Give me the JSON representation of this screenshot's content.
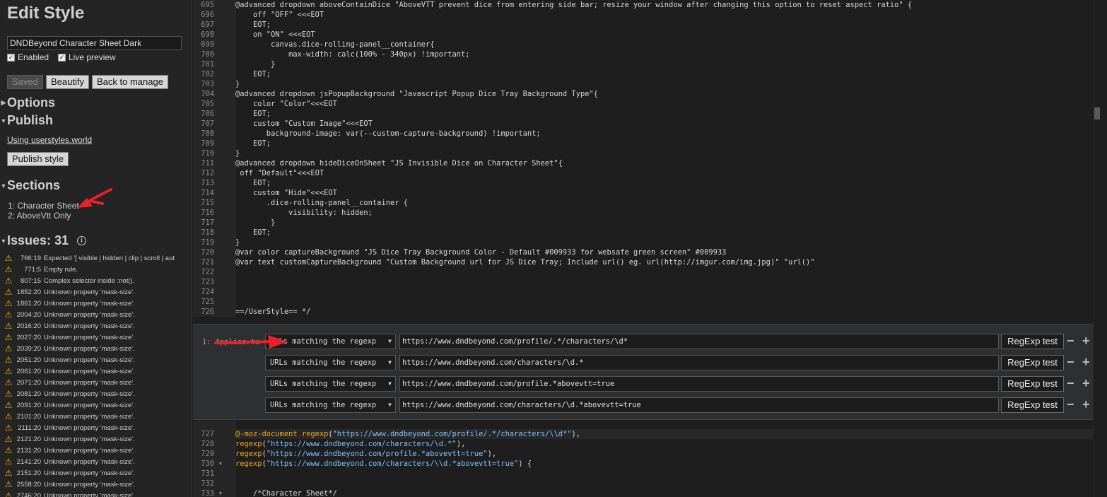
{
  "sidebar": {
    "title": "Edit Style",
    "style_name": "DNDBeyond Character Sheet Dark",
    "enabled_label": "Enabled",
    "live_preview_label": "Live preview",
    "buttons": {
      "saved": "Saved",
      "beautify": "Beautify",
      "back": "Back to manage"
    },
    "options_heading": "Options",
    "publish_heading": "Publish",
    "publish_link": "Using userstyles.world",
    "publish_button": "Publish style",
    "sections_heading": "Sections",
    "sections": [
      "1: Character Sheet",
      "2: AboveVtt Only"
    ],
    "issues_heading": "Issues: 31",
    "issues": [
      {
        "pos": "766:19",
        "msg": "Expected '[ visible | hidden | clip | scroll | aut"
      },
      {
        "pos": "771:5",
        "msg": "Empty rule."
      },
      {
        "pos": "807:15",
        "msg": "Complex selector inside :not()."
      },
      {
        "pos": "1852:20",
        "msg": "Unknown property 'mask-size'."
      },
      {
        "pos": "1861:20",
        "msg": "Unknown property 'mask-size'."
      },
      {
        "pos": "2004:20",
        "msg": "Unknown property 'mask-size'."
      },
      {
        "pos": "2016:20",
        "msg": "Unknown property 'mask-size'."
      },
      {
        "pos": "2027:20",
        "msg": "Unknown property 'mask-size'."
      },
      {
        "pos": "2039:20",
        "msg": "Unknown property 'mask-size'."
      },
      {
        "pos": "2051:20",
        "msg": "Unknown property 'mask-size'."
      },
      {
        "pos": "2061:20",
        "msg": "Unknown property 'mask-size'."
      },
      {
        "pos": "2071:20",
        "msg": "Unknown property 'mask-size'."
      },
      {
        "pos": "2081:20",
        "msg": "Unknown property 'mask-size'."
      },
      {
        "pos": "2091:20",
        "msg": "Unknown property 'mask-size'."
      },
      {
        "pos": "2101:20",
        "msg": "Unknown property 'mask-size'."
      },
      {
        "pos": "2111:20",
        "msg": "Unknown property 'mask-size'."
      },
      {
        "pos": "2121:20",
        "msg": "Unknown property 'mask-size'."
      },
      {
        "pos": "2131:20",
        "msg": "Unknown property 'mask-size'."
      },
      {
        "pos": "2141:20",
        "msg": "Unknown property 'mask-size'."
      },
      {
        "pos": "2151:20",
        "msg": "Unknown property 'mask-size'."
      },
      {
        "pos": "2558:20",
        "msg": "Unknown property 'mask-size'."
      },
      {
        "pos": "2746:20",
        "msg": "Unknown property 'mask-size'."
      }
    ]
  },
  "editor": {
    "top_lines": [
      {
        "n": "695",
        "text": "@advanced dropdown aboveContainDice \"AboveVTT prevent dice from entering side bar; resize your window after changing this option to reset aspect ratio\" {"
      },
      {
        "n": "696",
        "text": "    off \"OFF\" <<<EOT"
      },
      {
        "n": "697",
        "text": "    EOT;"
      },
      {
        "n": "698",
        "text": "    on \"ON\" <<<EOT"
      },
      {
        "n": "699",
        "text": "        canvas.dice-rolling-panel__container{"
      },
      {
        "n": "700",
        "text": "            max-width: calc(100% - 340px) !important;"
      },
      {
        "n": "701",
        "text": "        }"
      },
      {
        "n": "702",
        "text": "    EOT;"
      },
      {
        "n": "703",
        "text": "}"
      },
      {
        "n": "704",
        "text": "@advanced dropdown jsPopupBackground \"Javascript Popup Dice Tray Background Type\"{"
      },
      {
        "n": "705",
        "text": "    color \"Color\"<<<EOT"
      },
      {
        "n": "706",
        "text": "    EOT;"
      },
      {
        "n": "707",
        "text": "    custom \"Custom Image\"<<<EOT"
      },
      {
        "n": "708",
        "text": "       background-image: var(--custom-capture-background) !important;"
      },
      {
        "n": "709",
        "text": "    EOT;"
      },
      {
        "n": "710",
        "text": "}"
      },
      {
        "n": "711",
        "text": "@advanced dropdown hideDiceOnSheet \"JS Invisible Dice on Character Sheet\"{"
      },
      {
        "n": "712",
        "text": " off \"Default\"<<<EOT"
      },
      {
        "n": "713",
        "text": "    EOT;"
      },
      {
        "n": "714",
        "text": "    custom \"Hide\"<<<EOT"
      },
      {
        "n": "715",
        "text": "       .dice-rolling-panel__container {"
      },
      {
        "n": "716",
        "text": "            visibility: hidden;"
      },
      {
        "n": "717",
        "text": "        }"
      },
      {
        "n": "718",
        "text": "    EOT;"
      },
      {
        "n": "719",
        "text": "}"
      },
      {
        "n": "720",
        "text": "@var color captureBackground \"JS Dice Tray Background Color - Default #009933 for websafe green screen\" #009933"
      },
      {
        "n": "721",
        "text": "@var text customCaptureBackground \"Custom Background url for JS Dice Tray; Include url() eg. url(http://imgur.com/img.jpg)\" \"url()\""
      },
      {
        "n": "722",
        "text": ""
      },
      {
        "n": "723",
        "text": ""
      },
      {
        "n": "724",
        "text": ""
      },
      {
        "n": "725",
        "text": ""
      },
      {
        "n": "726",
        "text": "==/UserStyle== */"
      }
    ],
    "applies_label": "1: Applies to",
    "applies": [
      {
        "type": "URLs matching the regexp",
        "value": "https://www.dndbeyond.com/profile/.*/characters/\\d*",
        "test": "RegExp test"
      },
      {
        "type": "URLs matching the regexp",
        "value": "https://www.dndbeyond.com/characters/\\d.*",
        "test": "RegExp test"
      },
      {
        "type": "URLs matching the regexp",
        "value": "https://www.dndbeyond.com/profile.*abovevtt=true",
        "test": "RegExp test"
      },
      {
        "type": "URLs matching the regexp",
        "value": "https://www.dndbeyond.com/characters/\\d.*abovevtt=true",
        "test": "RegExp test"
      }
    ],
    "bottom_lines": [
      {
        "n": "727",
        "parts": [
          {
            "k": "kw",
            "t": "@-moz-document"
          },
          {
            "k": "",
            "t": " "
          },
          {
            "k": "kw",
            "t": "regexp"
          },
          {
            "k": "",
            "t": "("
          },
          {
            "k": "str",
            "t": "\"https://www.dndbeyond.com/profile/.*/characters/\\\\d*\""
          },
          {
            "k": "",
            "t": "),"
          }
        ]
      },
      {
        "n": "728",
        "parts": [
          {
            "k": "kw",
            "t": "regexp"
          },
          {
            "k": "",
            "t": "("
          },
          {
            "k": "str",
            "t": "\"https://www.dndbeyond.com/characters/\\d.*\""
          },
          {
            "k": "",
            "t": "),"
          }
        ]
      },
      {
        "n": "729",
        "parts": [
          {
            "k": "kw",
            "t": "regexp"
          },
          {
            "k": "",
            "t": "("
          },
          {
            "k": "str",
            "t": "\"https://www.dndbeyond.com/profile.*abovevtt=true\""
          },
          {
            "k": "",
            "t": "),"
          }
        ]
      },
      {
        "n": "730",
        "fold": true,
        "parts": [
          {
            "k": "kw",
            "t": "regexp"
          },
          {
            "k": "",
            "t": "("
          },
          {
            "k": "str",
            "t": "\"https://www.dndbeyond.com/characters/\\\\d.*abovevtt=true\""
          },
          {
            "k": "",
            "t": ") {"
          }
        ]
      },
      {
        "n": "731",
        "parts": []
      },
      {
        "n": "732",
        "parts": []
      },
      {
        "n": "733",
        "fold": true,
        "parts": [
          {
            "k": "",
            "t": "    /*Character Sheet*/"
          }
        ]
      }
    ]
  },
  "icons": {
    "warning": "warning-icon",
    "info": "info-icon",
    "remove": "minus-icon",
    "add": "plus-icon",
    "dropdown": "chevron-down-icon"
  },
  "colors": {
    "keyword": "#f2a71b",
    "string": "#7fc0ff",
    "warning": "#f0b400",
    "annotation_arrow": "#e8202a"
  }
}
